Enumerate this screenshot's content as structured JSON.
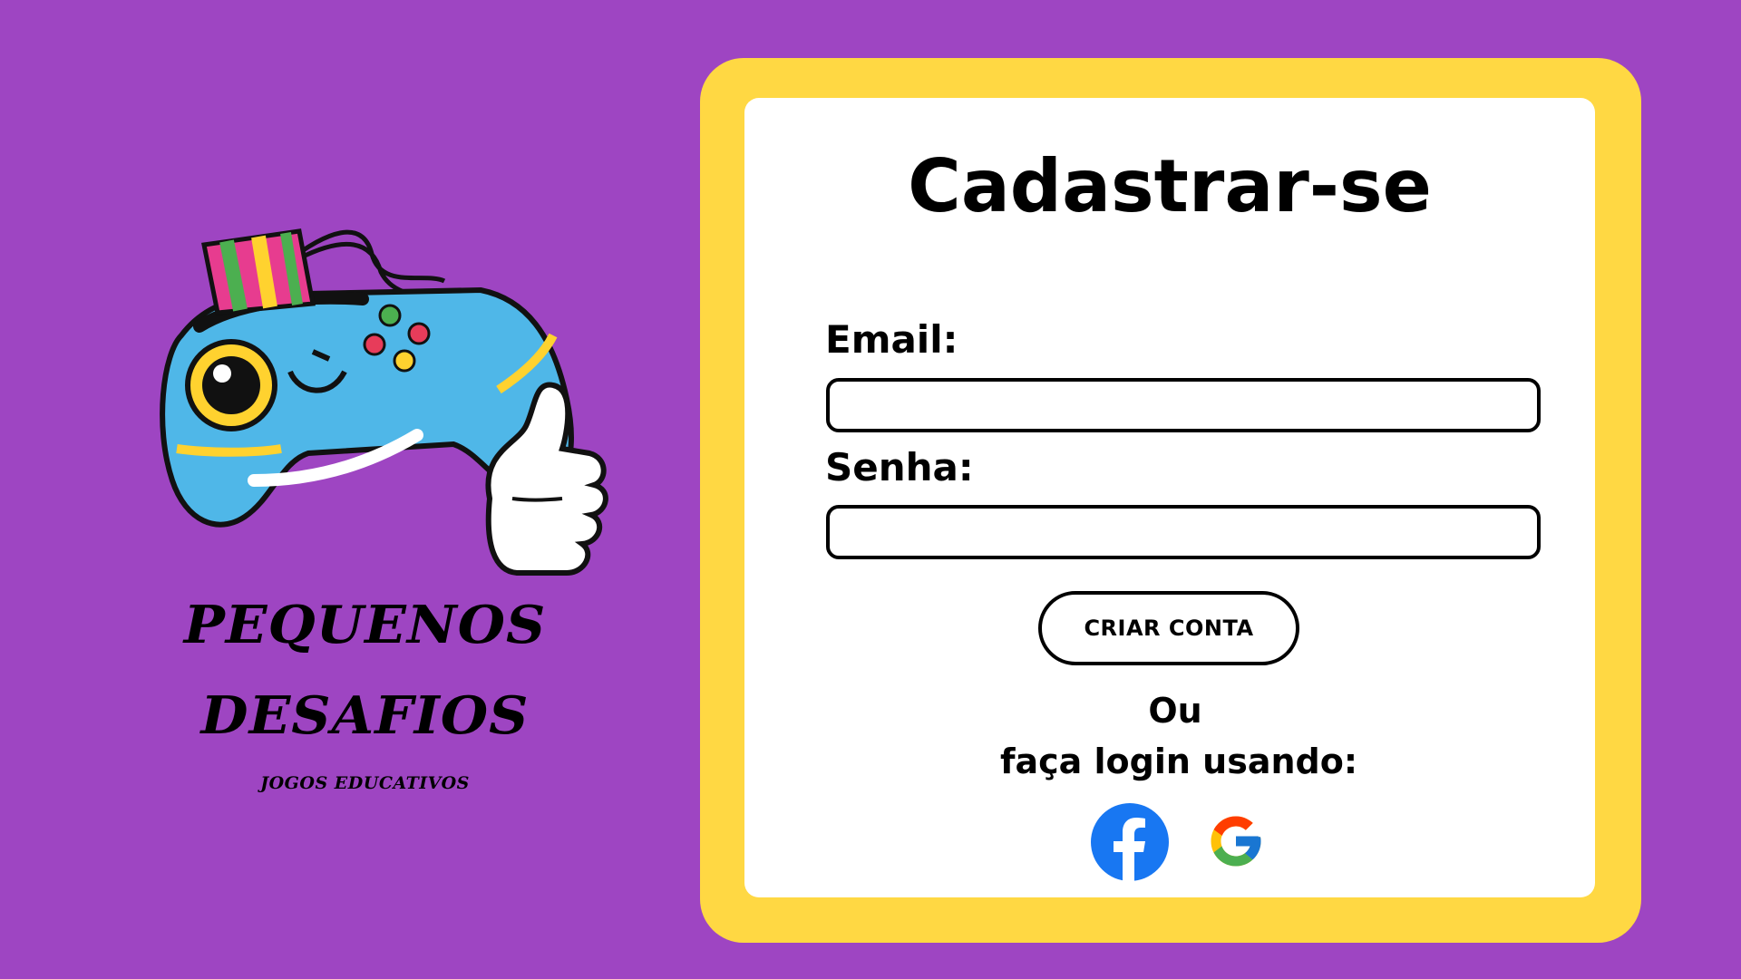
{
  "colors": {
    "background": "#9e45c2",
    "card_border": "#ffd843",
    "card_bg": "#ffffff",
    "facebook": "#1877f2"
  },
  "brand": {
    "line1": "PEQUENOS",
    "line2": "DESAFIOS",
    "tagline": "JOGOS EDUCATIVOS",
    "logo_icon": "gamepad-mascot-icon"
  },
  "form": {
    "title": "Cadastrar-se",
    "email_label": "Email:",
    "email_value": "",
    "password_label": "Senha:",
    "password_value": "",
    "submit_label": "CRIAR CONTA",
    "or_line1": "Ou",
    "or_line2": "faça login usando:"
  },
  "social": {
    "facebook_icon": "facebook-icon",
    "google_icon": "google-icon"
  }
}
